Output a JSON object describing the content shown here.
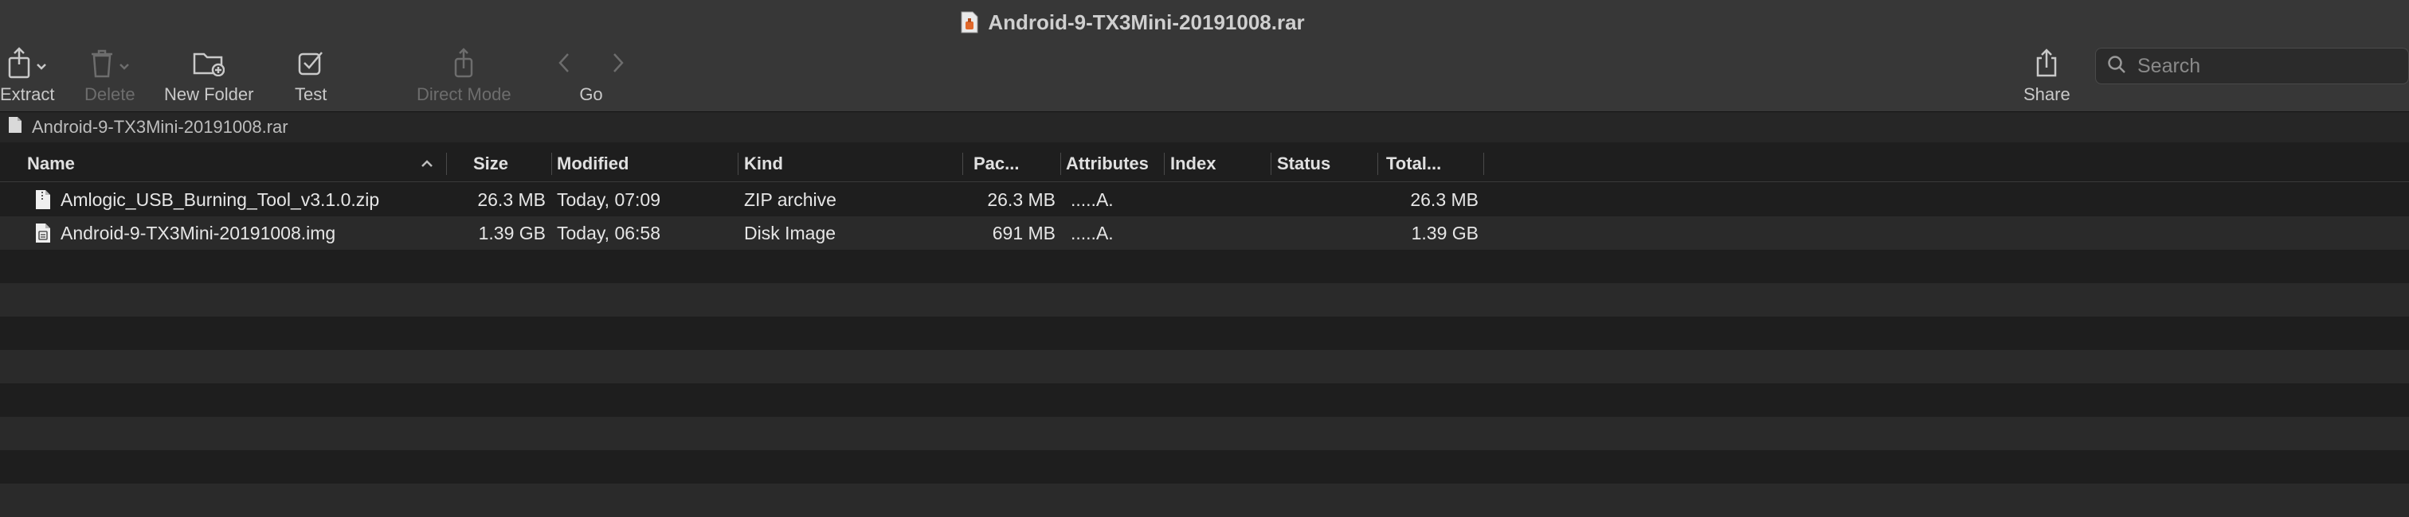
{
  "window": {
    "title": "Android-9-TX3Mini-20191008.rar"
  },
  "toolbar": {
    "extract_label": "Extract",
    "delete_label": "Delete",
    "new_folder_label": "New Folder",
    "test_label": "Test",
    "direct_mode_label": "Direct Mode",
    "go_label": "Go",
    "share_label": "Share"
  },
  "search": {
    "placeholder": "Search",
    "value": ""
  },
  "path": {
    "current": "Android-9-TX3Mini-20191008.rar"
  },
  "columns": {
    "name": "Name",
    "size": "Size",
    "modified": "Modified",
    "kind": "Kind",
    "packed": "Pac...",
    "attributes": "Attributes",
    "index": "Index",
    "status": "Status",
    "total": "Total..."
  },
  "files": [
    {
      "name": "Amlogic_USB_Burning_Tool_v3.1.0.zip",
      "size": "26.3 MB",
      "modified": "Today, 07:09",
      "kind": "ZIP archive",
      "packed": "26.3 MB",
      "attributes": ".....A.",
      "index": "",
      "status": "",
      "total": "26.3 MB"
    },
    {
      "name": "Android-9-TX3Mini-20191008.img",
      "size": "1.39 GB",
      "modified": "Today, 06:58",
      "kind": "Disk Image",
      "packed": "691 MB",
      "attributes": ".....A.",
      "index": "",
      "status": "",
      "total": "1.39 GB"
    }
  ],
  "colors": {
    "accent": "#e0682b",
    "background": "#1e1e1e",
    "toolbar": "#373737"
  }
}
